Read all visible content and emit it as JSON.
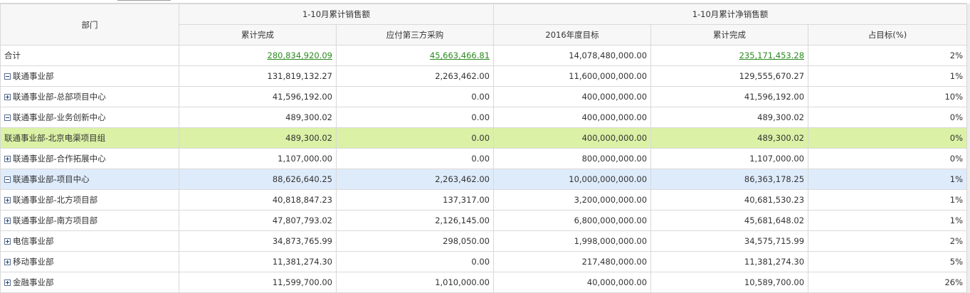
{
  "header": {
    "department": "部门",
    "group_sales": "1-10月累计销售额",
    "group_net": "1-10月累计净销售额",
    "sub": [
      "累计完成",
      "应付第三方采购",
      "2016年度目标",
      "累计完成",
      "占目标(%)"
    ]
  },
  "rows": [
    {
      "dept": "合计",
      "level": "total",
      "toggle": "none",
      "v1": "280,834,920.09",
      "v2": "45,663,466.81",
      "v3": "14,078,480,000.00",
      "v4": "235,171,453.28",
      "v5": "2%",
      "links": true
    },
    {
      "dept": "联通事业部",
      "level": 0,
      "toggle": "minus",
      "v1": "131,819,132.27",
      "v2": "2,263,462.00",
      "v3": "11,600,000,000.00",
      "v4": "129,555,670.27",
      "v5": "1%"
    },
    {
      "dept": "联通事业部-总部项目中心",
      "level": 1,
      "toggle": "plus",
      "v1": "41,596,192.00",
      "v2": "0.00",
      "v3": "400,000,000.00",
      "v4": "41,596,192.00",
      "v5": "10%"
    },
    {
      "dept": "联通事业部-业务创新中心",
      "level": 1,
      "toggle": "minus",
      "v1": "489,300.02",
      "v2": "0.00",
      "v3": "400,000,000.00",
      "v4": "489,300.02",
      "v5": "0%"
    },
    {
      "dept": "联通事业部-北京电渠项目组",
      "level": 3,
      "toggle": "none",
      "v1": "489,300.02",
      "v2": "0.00",
      "v3": "400,000,000.00",
      "v4": "489,300.02",
      "v5": "0%",
      "state": "selected"
    },
    {
      "dept": "联通事业部-合作拓展中心",
      "level": 1,
      "toggle": "plus",
      "v1": "1,107,000.00",
      "v2": "0.00",
      "v3": "800,000,000.00",
      "v4": "1,107,000.00",
      "v5": "0%"
    },
    {
      "dept": "联通事业部-项目中心",
      "level": 1,
      "toggle": "minus",
      "v1": "88,626,640.25",
      "v2": "2,263,462.00",
      "v3": "10,000,000,000.00",
      "v4": "86,363,178.25",
      "v5": "1%",
      "state": "hover"
    },
    {
      "dept": "联通事业部-北方项目部",
      "level": 2,
      "toggle": "plus",
      "v1": "40,818,847.23",
      "v2": "137,317.00",
      "v3": "3,200,000,000.00",
      "v4": "40,681,530.23",
      "v5": "1%"
    },
    {
      "dept": "联通事业部-南方项目部",
      "level": 2,
      "toggle": "plus",
      "v1": "47,807,793.02",
      "v2": "2,126,145.00",
      "v3": "6,800,000,000.00",
      "v4": "45,681,648.02",
      "v5": "1%"
    },
    {
      "dept": "电信事业部",
      "level": 0,
      "toggle": "plus",
      "v1": "34,873,765.99",
      "v2": "298,050.00",
      "v3": "1,998,000,000.00",
      "v4": "34,575,715.99",
      "v5": "2%"
    },
    {
      "dept": "移动事业部",
      "level": 0,
      "toggle": "plus",
      "v1": "11,381,274.30",
      "v2": "0.00",
      "v3": "217,480,000.00",
      "v4": "11,381,274.30",
      "v5": "5%"
    },
    {
      "dept": "金融事业部",
      "level": 0,
      "toggle": "plus",
      "v1": "11,599,700.00",
      "v2": "1,010,000.00",
      "v3": "40,000,000.00",
      "v4": "10,589,700.00",
      "v5": "26%"
    }
  ],
  "colors": {
    "selected_row": "#dbf1a6",
    "hover_row": "#deebfb",
    "link": "#2b8a1f",
    "header_bg": "#f7f7f7",
    "border": "#d9d9d9"
  }
}
